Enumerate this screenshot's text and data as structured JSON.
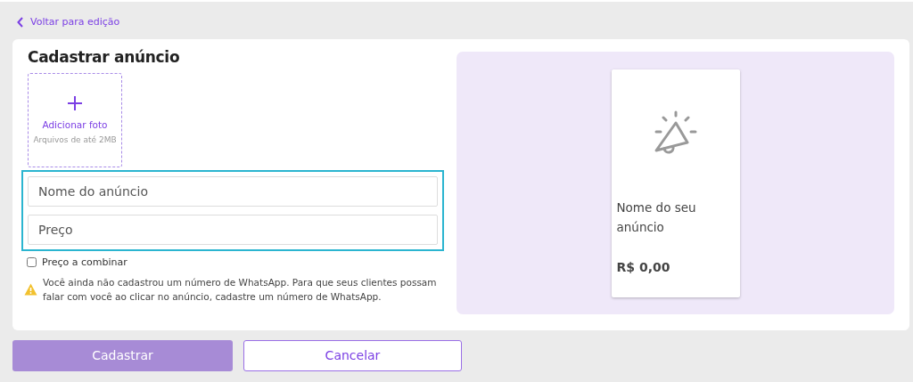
{
  "back_link": {
    "label": "Voltar para edição"
  },
  "form": {
    "title": "Cadastrar anúncio",
    "photo_upload": {
      "label": "Adicionar foto",
      "hint": "Arquivos de até 2MB"
    },
    "fields": [
      {
        "placeholder": "Nome do anúncio"
      },
      {
        "placeholder": "Preço"
      }
    ],
    "price_negotiable": {
      "label": "Preço a combinar",
      "checked": false
    },
    "warning": "Você ainda não cadastrou um número de WhatsApp. Para que seus clientes possam falar com você ao clicar no anúncio, cadastre um número de WhatsApp."
  },
  "preview": {
    "name": "Nome do seu anúncio",
    "price": "R$ 0,00"
  },
  "buttons": [
    {
      "label": "Cadastrar",
      "kind": "primary",
      "disabled": true
    },
    {
      "label": "Cancelar",
      "kind": "secondary",
      "disabled": false
    }
  ]
}
